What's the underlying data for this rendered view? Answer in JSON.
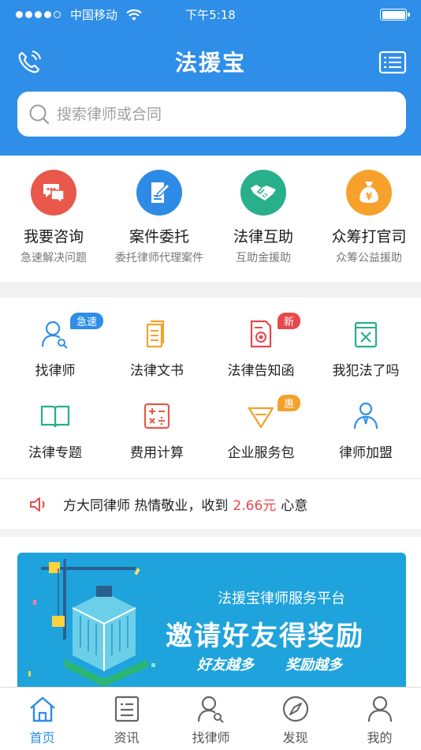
{
  "status_bar": {
    "carrier": "中国移动",
    "time": "下午5:18"
  },
  "header": {
    "title": "法援宝"
  },
  "search": {
    "placeholder": "搜索律师或合同"
  },
  "quick_services": [
    {
      "label": "我要咨询",
      "sub": "急速解决问题",
      "icon": "chat-icon",
      "color": "#e8584b"
    },
    {
      "label": "案件委托",
      "sub": "委托律师代理案件",
      "icon": "document-pen-icon",
      "color": "#2d8be6"
    },
    {
      "label": "法律互助",
      "sub": "互助金援助",
      "icon": "handshake-icon",
      "color": "#28b08a"
    },
    {
      "label": "众筹打官司",
      "sub": "众筹公益援助",
      "icon": "money-bag-icon",
      "color": "#f5a12b"
    }
  ],
  "grid": [
    {
      "label": "找律师",
      "badge": "急速"
    },
    {
      "label": "法律文书"
    },
    {
      "label": "法律告知函",
      "badge": "新"
    },
    {
      "label": "我犯法了吗"
    },
    {
      "label": "法律专题"
    },
    {
      "label": "费用计算"
    },
    {
      "label": "企业服务包",
      "badge": "惠"
    },
    {
      "label": "律师加盟"
    }
  ],
  "notice": {
    "prefix": "方大同律师 热情敬业，收到",
    "amount": "2.66元",
    "suffix": "心意"
  },
  "banner": {
    "top_text": "法援宝律师服务平台",
    "main_text": "邀请好友得奖励",
    "sub_left": "好友越多",
    "sub_right": "奖励越多"
  },
  "tabbar": [
    {
      "label": "首页",
      "active": true
    },
    {
      "label": "资讯"
    },
    {
      "label": "找律师"
    },
    {
      "label": "发现"
    },
    {
      "label": "我的"
    }
  ],
  "colors": {
    "primary": "#2e8ee8",
    "red": "#e8484d",
    "orange": "#f5a12b",
    "teal": "#28b08a"
  }
}
